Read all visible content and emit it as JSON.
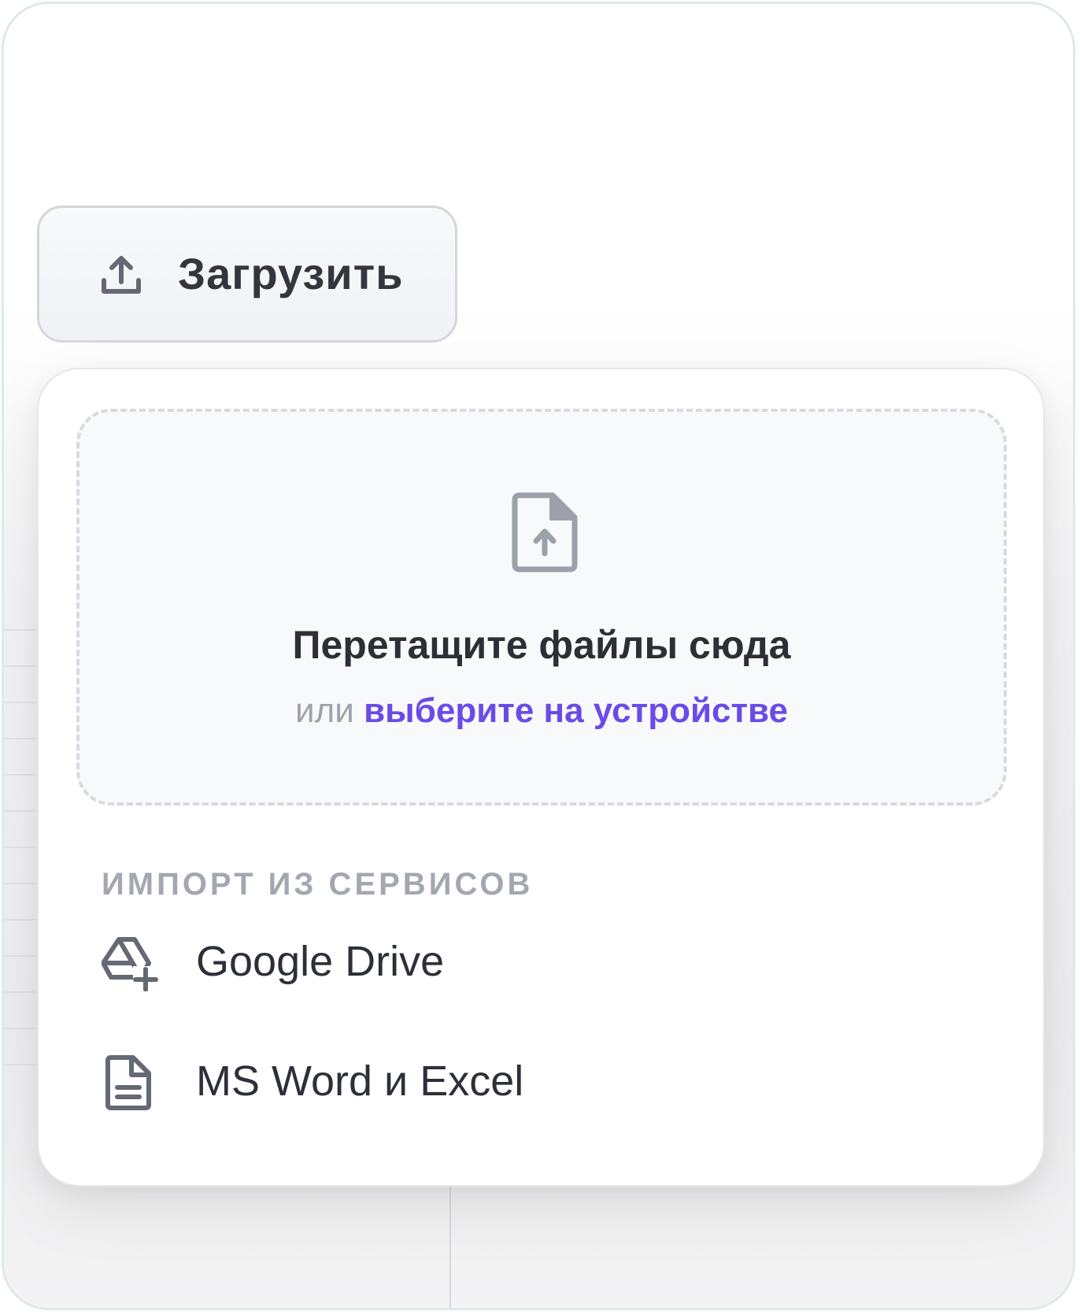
{
  "upload_button": {
    "icon": "upload-icon",
    "label": "Загрузить"
  },
  "dropzone": {
    "icon": "file-upload-icon",
    "title": "Перетащите файлы сюда",
    "or_text": "или",
    "choose_link": "выберите на устройстве"
  },
  "import": {
    "heading": "ИМПОРТ ИЗ СЕРВИСОВ",
    "items": [
      {
        "icon": "google-drive-add-icon",
        "label": "Google Drive"
      },
      {
        "icon": "document-icon",
        "label": "MS Word и Excel"
      }
    ]
  },
  "colors": {
    "accent": "#6a4be8",
    "text_primary": "#2c2f36",
    "text_muted": "#a3a7b0",
    "border": "#d8dade"
  }
}
